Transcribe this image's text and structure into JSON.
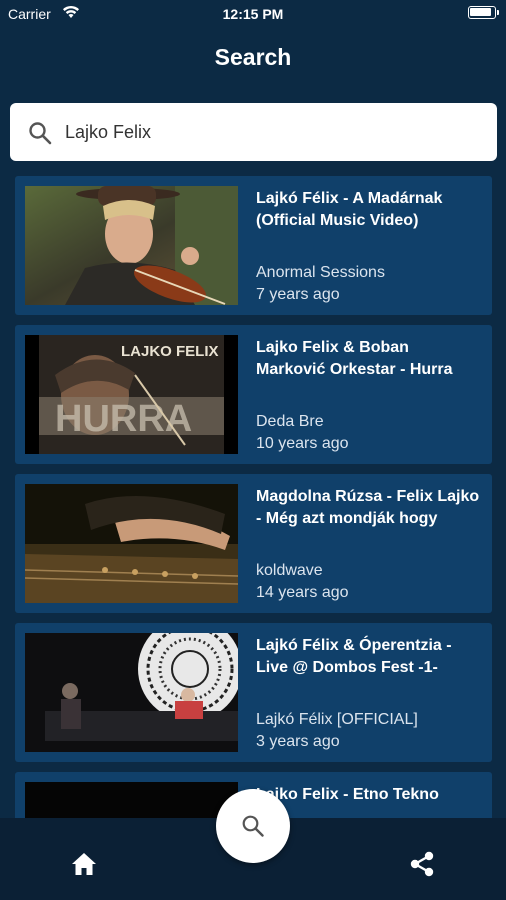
{
  "status_bar": {
    "carrier": "Carrier",
    "time": "12:15 PM"
  },
  "header": {
    "title": "Search"
  },
  "search": {
    "value": "Lajko Felix",
    "icon": "search-icon"
  },
  "results": [
    {
      "title": "Lajkó Félix - A Madárnak (Official Music Video)",
      "channel": "Anormal Sessions",
      "age": "7 years ago",
      "thumb_caption": ""
    },
    {
      "title": "Lajko Felix & Boban Marković Orkestar - Hurra",
      "channel": "Deda Bre",
      "age": "10 years ago",
      "thumb_caption": "LAJKO FELIX"
    },
    {
      "title": "Magdolna Rúzsa - Felix Lajko - Még azt mondják hogy",
      "channel": "koldwave",
      "age": "14 years ago",
      "thumb_caption": ""
    },
    {
      "title": "Lajkó Félix & Óperentzia - Live @ Dombos Fest -1-",
      "channel": "Lajkó Félix [OFFICIAL]",
      "age": "3 years ago",
      "thumb_caption": ""
    },
    {
      "title": "Lajko Felix  - Etno Tekno",
      "channel": "",
      "age": "",
      "thumb_caption": ""
    }
  ],
  "bottom_bar": {
    "home_icon": "home-icon",
    "search_icon": "search-icon",
    "share_icon": "share-icon"
  },
  "colors": {
    "background": "#0c2a44",
    "card": "#10406a",
    "bottom_bar": "#0b2035"
  }
}
